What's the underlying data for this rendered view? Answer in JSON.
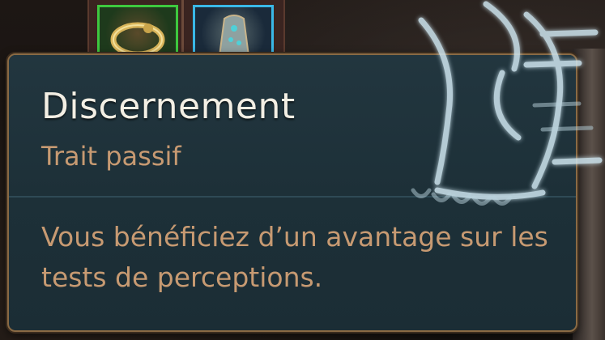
{
  "tooltip": {
    "title": "Discernement",
    "subtitle": "Trait passif",
    "description": "Vous bénéficiez d’un avantage sur les tests de perceptions."
  },
  "inventory": {
    "slots": [
      {
        "icon": "ring-icon",
        "rarity_color": "#3ec83f"
      },
      {
        "icon": "boots-icon",
        "rarity_color": "#3ab8e6"
      }
    ]
  },
  "trait_icon": "foot-icon",
  "colors": {
    "title": "#f3efe4",
    "accent_text": "#c79a72",
    "panel_bg": "#1f333b",
    "border": "#8a6a44"
  }
}
